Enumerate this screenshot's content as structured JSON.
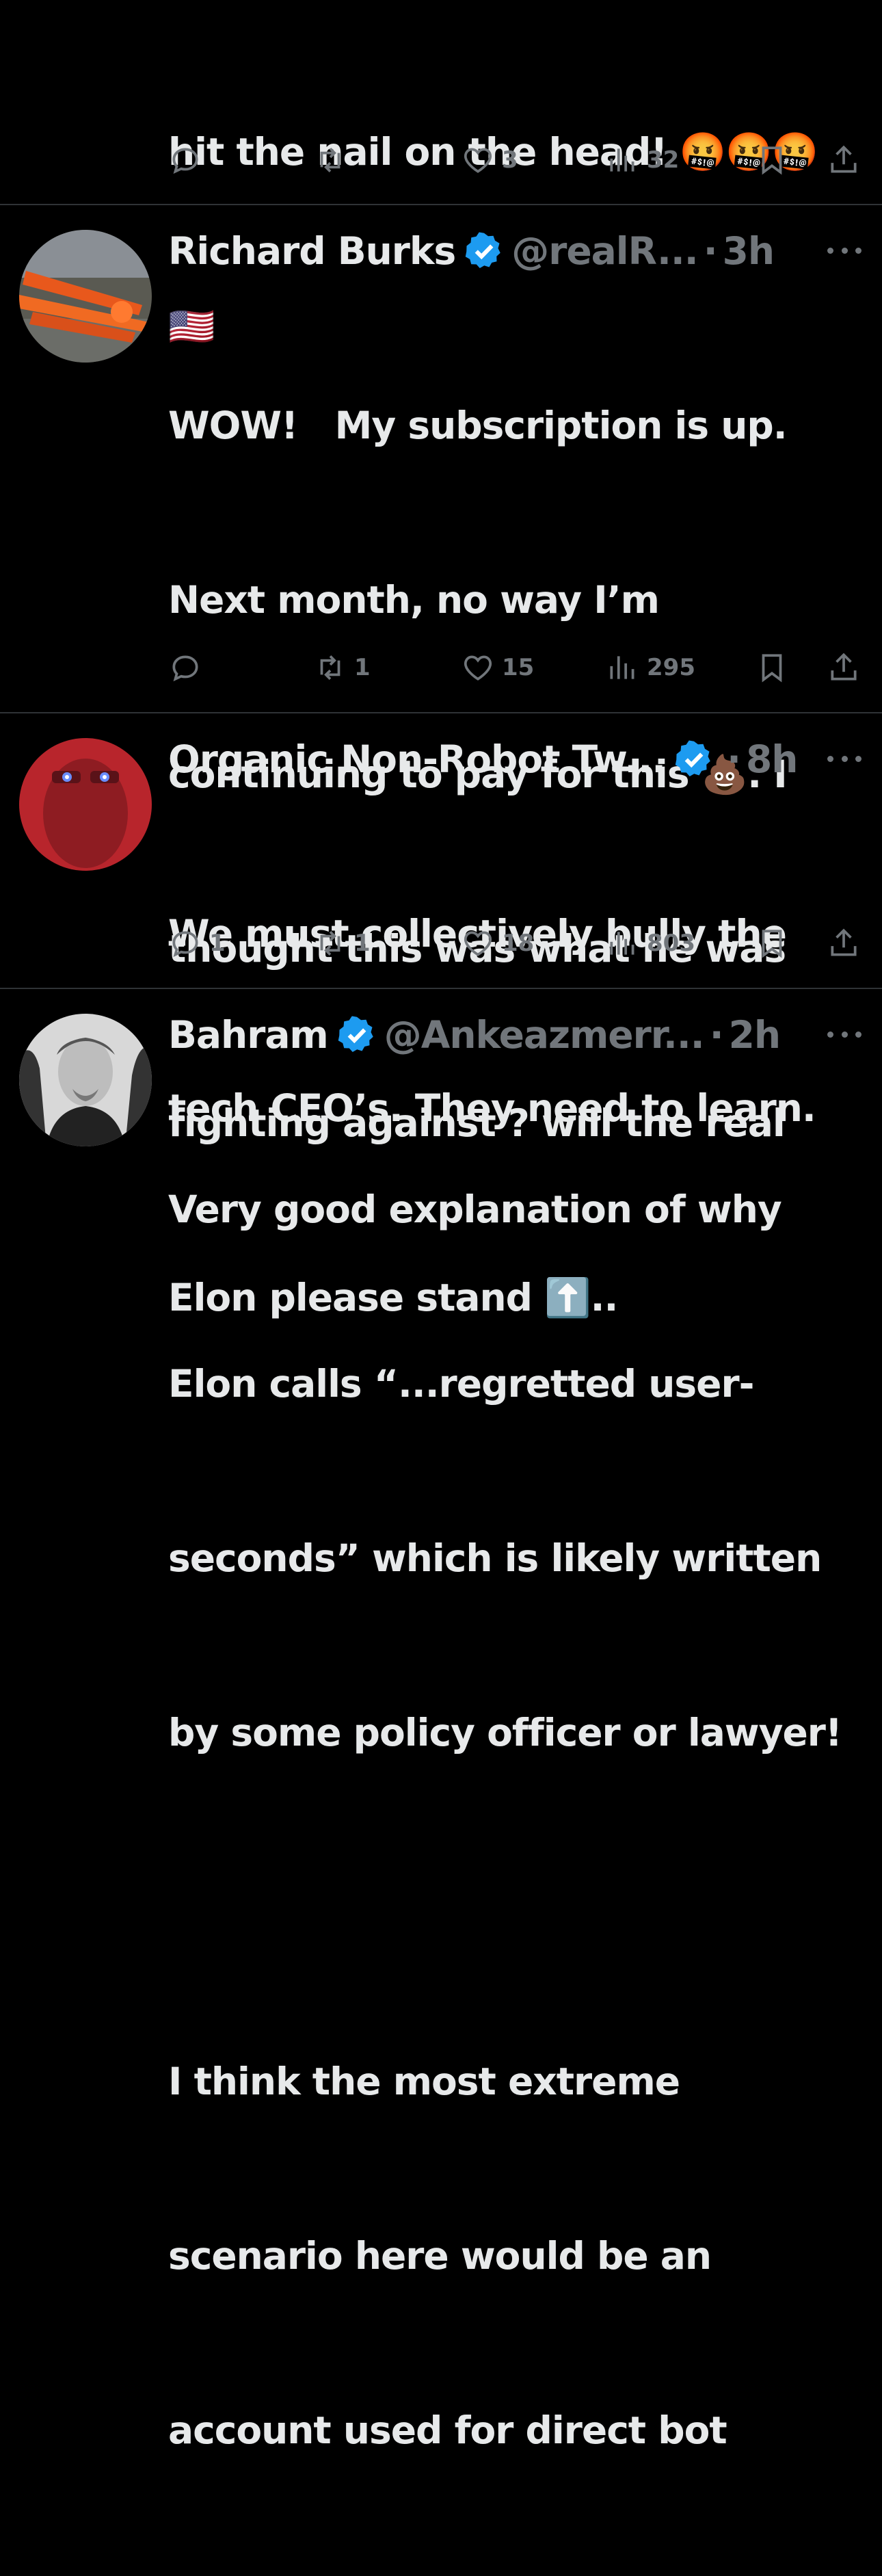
{
  "posts": [
    {
      "text_lines": [
        "hit the nail on the head! 🤬🤬🤬",
        "🇺🇸"
      ],
      "reply_count": "",
      "repost_count": "",
      "like_count": "3",
      "view_count": "32"
    },
    {
      "name": "Richard Burks",
      "handle": "@realR...",
      "separator": "·",
      "time": "3h",
      "text_lines": [
        "WOW!   My subscription is up.",
        "Next month, no way I’m",
        "continuing to pay for this 💩. I",
        "thought this was what he was",
        "fighting against ? will the real",
        "Elon please stand ⬆️.."
      ],
      "reply_count": "",
      "repost_count": "1",
      "like_count": "15",
      "view_count": "295"
    },
    {
      "name": "Organic Non-Robot Tw...",
      "handle": "",
      "separator": "·",
      "time": "8h",
      "text_lines": [
        "We must collectively bully the",
        "tech CEO’s. They need to learn."
      ],
      "reply_count": "1",
      "repost_count": "1",
      "like_count": "18",
      "view_count": "803"
    },
    {
      "name": "Bahram",
      "handle": "@Ankeazmerr...",
      "separator": "·",
      "time": "2h",
      "text_lines": [
        "Very good explanation of why",
        "Elon calls “...regretted user-",
        "seconds” which is likely written",
        "by some policy officer or lawyer!",
        "",
        "I think the most extreme",
        "scenario here would be an",
        "account used for direct bot"
      ]
    }
  ],
  "colors": {
    "background": "#000000",
    "text": "#e7e9ea",
    "muted": "#71767b",
    "verified": "#1d9bf0",
    "divider": "#2f3336"
  },
  "icons": [
    "reply-icon",
    "repost-icon",
    "like-icon",
    "views-icon",
    "bookmark-icon",
    "share-icon",
    "verified-badge-icon",
    "more-icon"
  ]
}
